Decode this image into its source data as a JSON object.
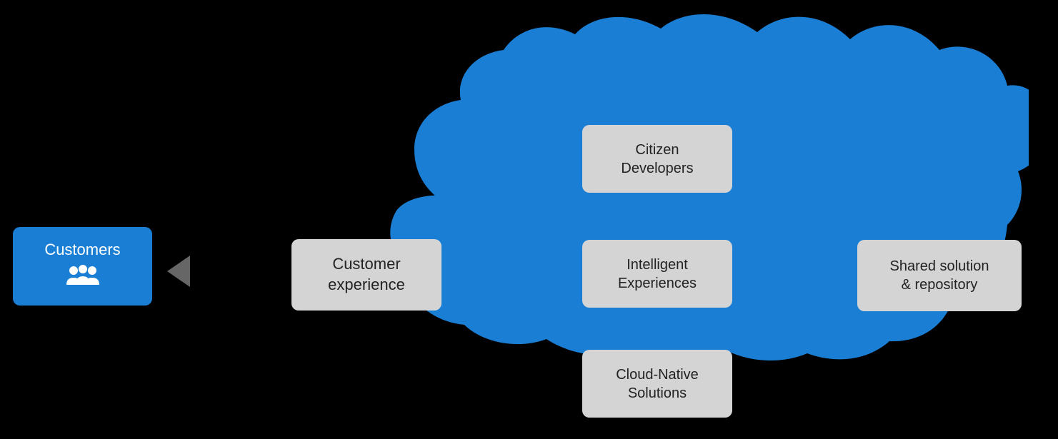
{
  "diagram": {
    "background": "#000000",
    "cloud_color": "#1a7fd4",
    "customers": {
      "label": "Customers",
      "icon": "👥"
    },
    "customer_experience": {
      "label": "Customer\nexperience"
    },
    "citizen_developers": {
      "label": "Citizen\nDevelopers"
    },
    "intelligent_experiences": {
      "label": "Intelligent\nExperiences"
    },
    "cloud_native_solutions": {
      "label": "Cloud-Native\nSolutions"
    },
    "shared_solution": {
      "label": "Shared solution\n& repository"
    }
  }
}
